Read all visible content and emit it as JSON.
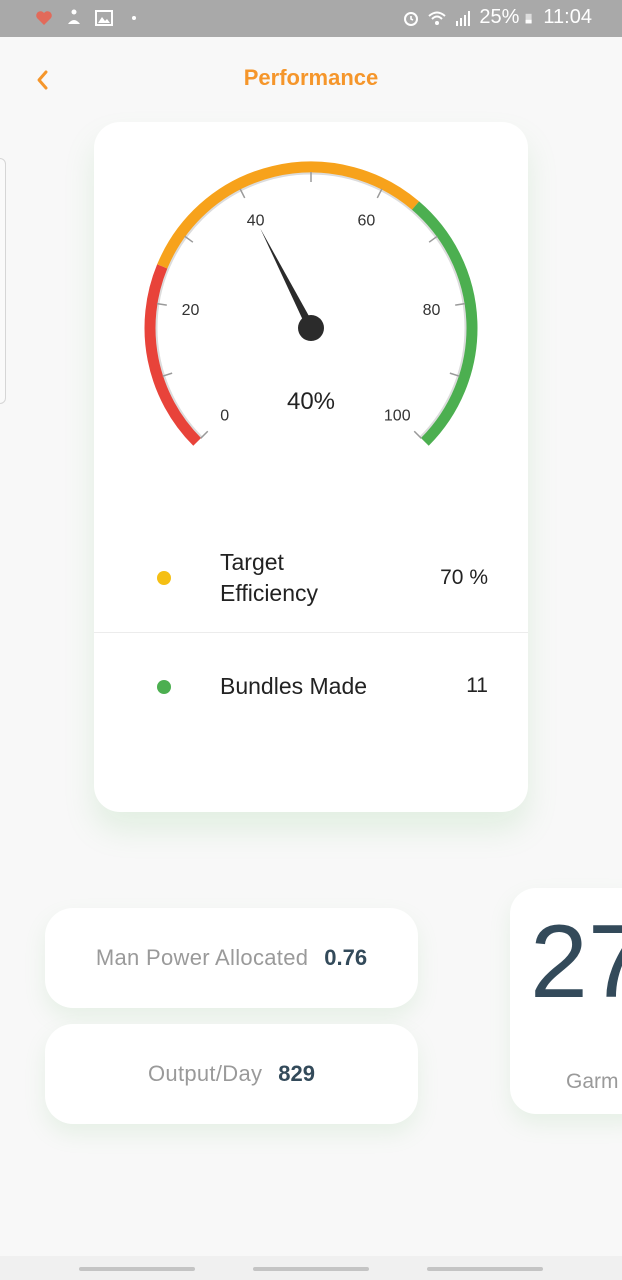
{
  "status_bar": {
    "battery": "25%",
    "time": "11:04",
    "left_icons": [
      "health-icon",
      "yoga-icon",
      "gallery-icon"
    ],
    "right_icons": [
      "alarm-icon",
      "wifi-icon",
      "signal-icon",
      "battery-icon"
    ]
  },
  "header": {
    "title": "Performance",
    "back_icon": "chevron-left-icon",
    "accent_color": "#f5962b"
  },
  "gauge": {
    "value_label": "40%",
    "value": 40,
    "ticks": [
      "0",
      "20",
      "40",
      "60",
      "80",
      "100"
    ],
    "range": [
      0,
      100
    ],
    "bands": [
      {
        "from": 0,
        "to": 25,
        "color": "#e8433a"
      },
      {
        "from": 25,
        "to": 65,
        "color": "#f7a21b"
      },
      {
        "from": 65,
        "to": 100,
        "color": "#4caf50"
      }
    ]
  },
  "legend": [
    {
      "label_line1": "Target",
      "label_line2": "Efficiency",
      "value": "70 %",
      "color": "#f5bf14"
    },
    {
      "label_line1": "Bundles Made",
      "value": "11",
      "color": "#4caf50"
    }
  ],
  "stats": [
    {
      "label": "Man Power Allocated",
      "value": "0.76"
    },
    {
      "label": "Output/Day",
      "value": "829"
    }
  ],
  "peek_card": {
    "number": "27",
    "label": "Garm"
  }
}
